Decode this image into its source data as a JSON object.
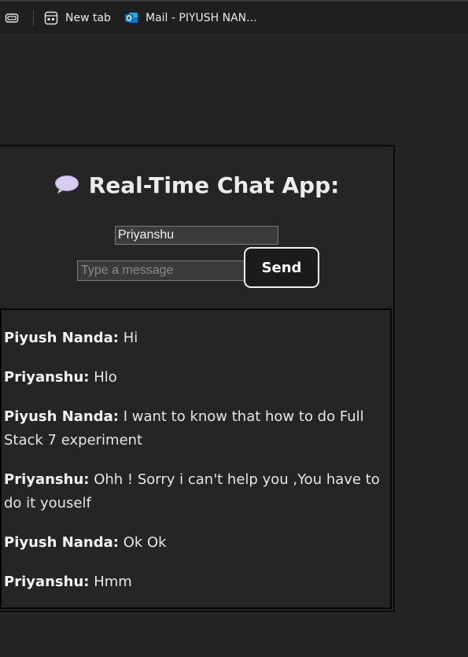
{
  "browser": {
    "tabs": [
      {
        "label": "New tab",
        "icon": "new-tab-icon"
      },
      {
        "label": "Mail - PIYUSH NAN...",
        "icon": "outlook-icon"
      }
    ],
    "actions_icon": "tab-actions-icon"
  },
  "app": {
    "title": "Real-Time Chat App:",
    "title_icon": "speech-bubble-icon",
    "name_input_value": "Priyanshu",
    "message_placeholder": "Type a message",
    "send_label": "Send"
  },
  "messages": [
    {
      "sender": "Piyush Nanda:",
      "text": " Hi"
    },
    {
      "sender": "Priyanshu:",
      "text": " Hlo"
    },
    {
      "sender": "Piyush Nanda:",
      "text": " I want to know that how to do Full Stack 7 experiment"
    },
    {
      "sender": "Priyanshu:",
      "text": " Ohh ! Sorry i can't help you ,You have to do it youself"
    },
    {
      "sender": "Piyush Nanda:",
      "text": " Ok Ok"
    },
    {
      "sender": "Priyanshu:",
      "text": " Hmm"
    }
  ],
  "colors": {
    "background": "#242424",
    "outlook_blue": "#0f6cbd",
    "bubble": "#d8ccf0"
  }
}
